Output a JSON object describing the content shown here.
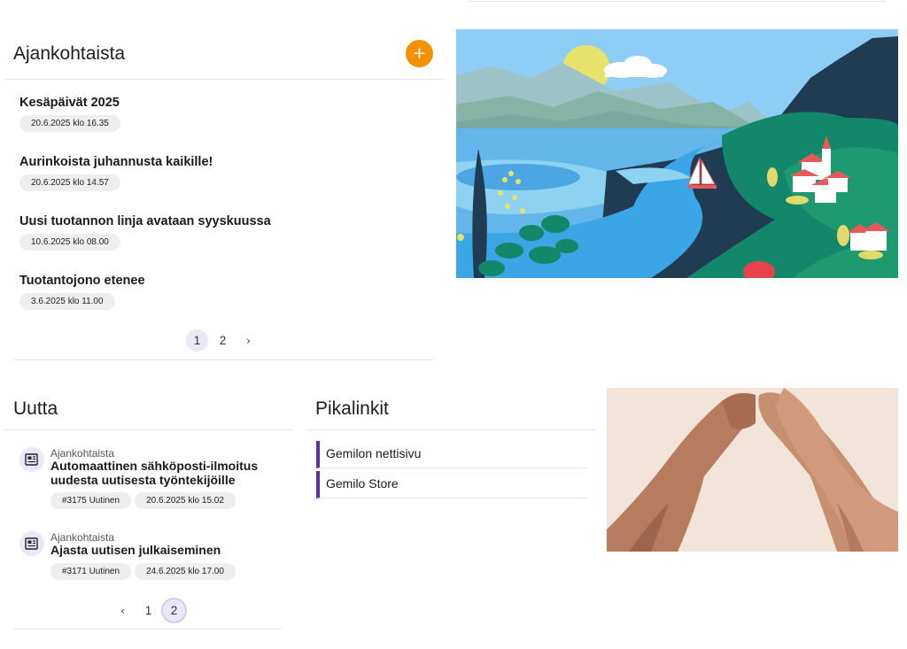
{
  "ajankohtaista": {
    "title": "Ajankohtaista",
    "add_label": "+",
    "items": [
      {
        "title": "Kesäpäivät 2025",
        "date": "20.6.2025 klo 16.35"
      },
      {
        "title": "Aurinkoista juhannusta kaikille!",
        "date": "20.6.2025 klo 14.57"
      },
      {
        "title": "Uusi tuotannon linja avataan syyskuussa",
        "date": "10.6.2025 klo 08.00"
      },
      {
        "title": "Tuotantojono etenee",
        "date": "3.6.2025 klo 11.00"
      }
    ],
    "pagination": {
      "pages": [
        "1",
        "2"
      ],
      "current": "1",
      "next_icon": "›"
    }
  },
  "uutta": {
    "title": "Uutta",
    "items": [
      {
        "category": "Ajankohtaista",
        "title": "Automaattinen sähköposti-ilmoitus uudesta uutisesta työntekijöille",
        "id": "#3175 Uutinen",
        "date": "20.6.2025 klo 15.02",
        "icon": "newspaper-icon"
      },
      {
        "category": "Ajankohtaista",
        "title": "Ajasta uutisen julkaiseminen",
        "id": "#3171 Uutinen",
        "date": "24.6.2025 klo 17.00",
        "icon": "newspaper-icon"
      }
    ],
    "pagination": {
      "prev_icon": "‹",
      "pages": [
        "1",
        "2"
      ],
      "current": "2"
    }
  },
  "pikalinkit": {
    "title": "Pikalinkit",
    "links": [
      {
        "label": "Gemilon nettisivu"
      },
      {
        "label": "Gemilo Store"
      }
    ]
  },
  "colors": {
    "accent_orange": "#f39200",
    "link_bar_purple": "#5b2fa8",
    "pager_active": "#ebe6f8"
  },
  "images": {
    "landscape": "landscape-illustration",
    "hands": "heart-hands-illustration"
  }
}
